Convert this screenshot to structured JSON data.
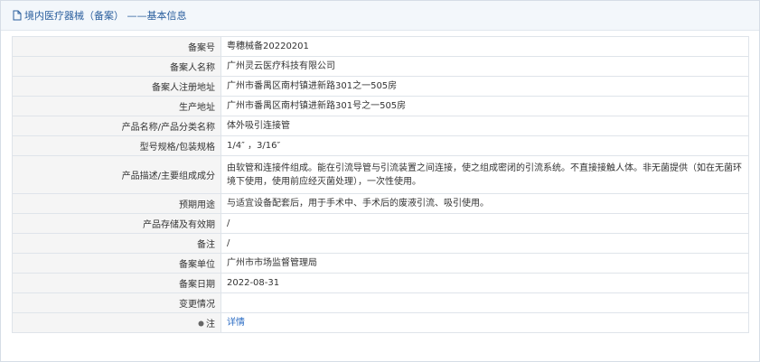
{
  "header": {
    "title": "境内医疗器械（备案） ——基本信息"
  },
  "rows": [
    {
      "label": "备案号",
      "value": "粤穗械备20220201"
    },
    {
      "label": "备案人名称",
      "value": "广州灵云医疗科技有限公司"
    },
    {
      "label": "备案人注册地址",
      "value": "广州市番禺区南村镇进新路301之一505房"
    },
    {
      "label": "生产地址",
      "value": "广州市番禺区南村镇进新路301号之一505房"
    },
    {
      "label": "产品名称/产品分类名称",
      "value": "体外吸引连接管"
    },
    {
      "label": "型号规格/包装规格",
      "value": "1/4″ ，3/16″"
    },
    {
      "label": "产品描述/主要组成成分",
      "value": "由软管和连接件组成。能在引流导管与引流装置之间连接，使之组成密闭的引流系统。不直接接触人体。非无菌提供（如在无菌环境下使用，使用前应经灭菌处理），一次性使用。"
    },
    {
      "label": "预期用途",
      "value": "与适宜设备配套后，用于手术中、手术后的废液引流、吸引使用。"
    },
    {
      "label": "产品存储及有效期",
      "value": "/"
    },
    {
      "label": "备注",
      "value": "/"
    },
    {
      "label": "备案单位",
      "value": "广州市市场监督管理局"
    },
    {
      "label": "备案日期",
      "value": "2022-08-31"
    },
    {
      "label": "变更情况",
      "value": ""
    },
    {
      "label": "注",
      "value": "详情"
    }
  ]
}
